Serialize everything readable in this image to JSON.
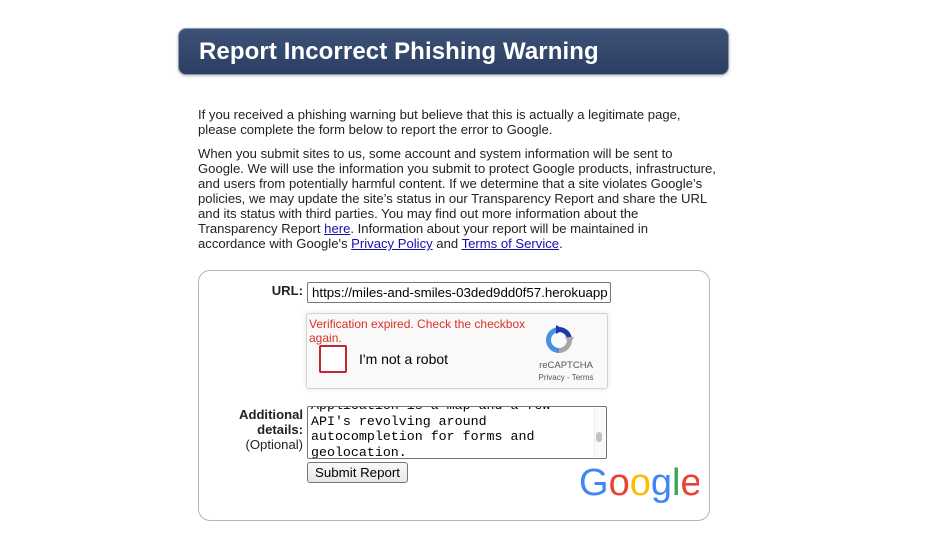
{
  "header": {
    "title": "Report Incorrect Phishing Warning"
  },
  "intro": {
    "paragraph1": "If you received a phishing warning but believe that this is actually a legitimate page, please complete the form below to report the error to Google.",
    "paragraph2_before_here": "When you submit sites to us, some account and system information will be sent to Google. We will use the information you submit to protect Google products, infrastructure, and users from potentially harmful content. If we determine that a site violates Google’s policies, we may update the site’s status in our Transparency Report and share the URL and its status with third parties. You may find out more information about the Transparency Report ",
    "here_link": "here",
    "paragraph2_mid": ". Information about your report will be maintained in accordance with Google's ",
    "privacy_link": "Privacy Policy",
    "and_text": " and ",
    "terms_link": "Terms of Service",
    "end_period": "."
  },
  "form": {
    "url_label": "URL:",
    "url_value": "https://miles-and-smiles-03ded9dd0f57.herokuapp",
    "recaptcha": {
      "error": "Verification expired. Check the checkbox again.",
      "label": "I'm not a robot",
      "brand": "reCAPTCHA",
      "privacy": "Privacy",
      "separator": " - ",
      "terms": "Terms"
    },
    "details_label_line1": "Additional",
    "details_label_line2": "details:",
    "details_optional": "(Optional)",
    "details_value": "Application is a map and a few\nAPI's revolving around\nautocompletion for forms and\ngeolocation.",
    "submit_label": "Submit Report",
    "google_logo": "Google"
  },
  "colors": {
    "header_bg": "#2f4266",
    "link": "#1a0dab",
    "error": "#d93025",
    "google_blue": "#4285F4",
    "google_red": "#EA4335",
    "google_yellow": "#FBBC05",
    "google_green": "#34A853"
  }
}
